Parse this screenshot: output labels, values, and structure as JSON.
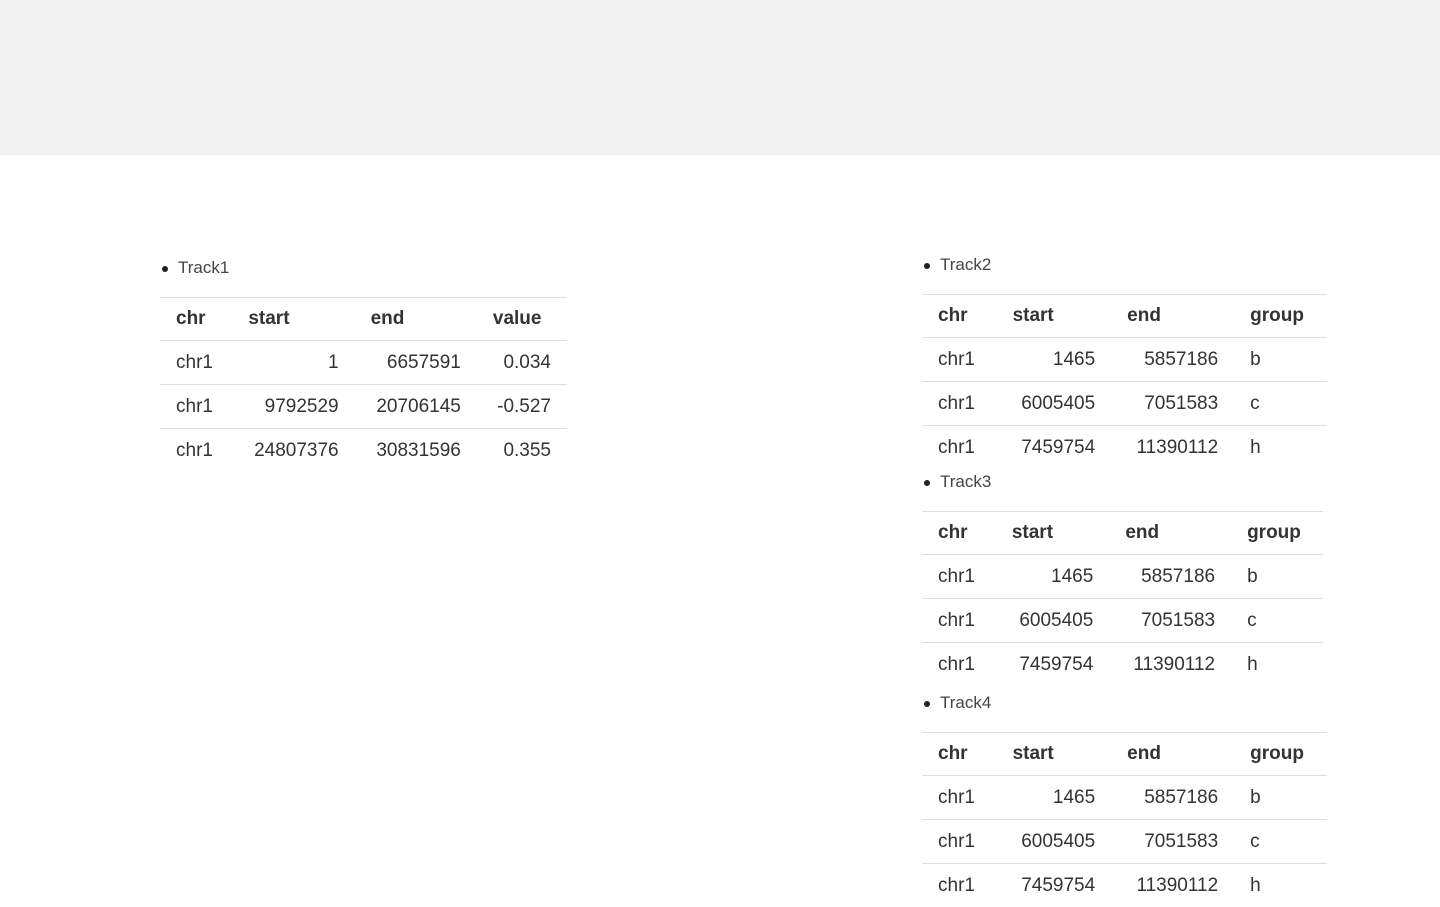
{
  "tracks": [
    {
      "title": "Track1",
      "headers": [
        "chr",
        "start",
        "end",
        "value"
      ],
      "rows": [
        [
          "chr1",
          "1",
          "6657591",
          "0.034"
        ],
        [
          "chr1",
          "9792529",
          "20706145",
          "-0.527"
        ],
        [
          "chr1",
          "24807376",
          "30831596",
          "0.355"
        ]
      ]
    },
    {
      "title": "Track2",
      "headers": [
        "chr",
        "start",
        "end",
        "group"
      ],
      "rows": [
        [
          "chr1",
          "1465",
          "5857186",
          "b"
        ],
        [
          "chr1",
          "6005405",
          "7051583",
          "c"
        ],
        [
          "chr1",
          "7459754",
          "11390112",
          "h"
        ]
      ]
    },
    {
      "title": "Track3",
      "headers": [
        "chr",
        "start",
        "end",
        "group"
      ],
      "rows": [
        [
          "chr1",
          "1465",
          "5857186",
          "b"
        ],
        [
          "chr1",
          "6005405",
          "7051583",
          "c"
        ],
        [
          "chr1",
          "7459754",
          "11390112",
          "h"
        ]
      ]
    },
    {
      "title": "Track4",
      "headers": [
        "chr",
        "start",
        "end",
        "group"
      ],
      "rows": [
        [
          "chr1",
          "1465",
          "5857186",
          "b"
        ],
        [
          "chr1",
          "6005405",
          "7051583",
          "c"
        ],
        [
          "chr1",
          "7459754",
          "11390112",
          "h"
        ]
      ]
    }
  ]
}
